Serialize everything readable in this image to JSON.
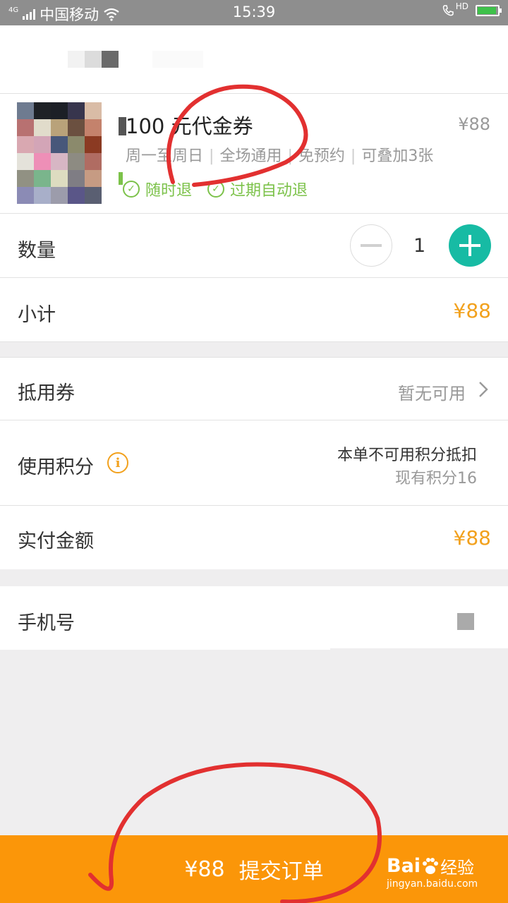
{
  "status": {
    "network": "4G",
    "carrier": "中国移动",
    "time": "15:39",
    "call_hd": "HD"
  },
  "product": {
    "title": "100 元代金券",
    "price": "¥88",
    "tags": [
      "周一至周日",
      "全场通用",
      "免预约",
      "可叠加3张"
    ],
    "badges": [
      "随时退",
      "过期自动退"
    ]
  },
  "quantity": {
    "label": "数量",
    "value": "1",
    "minus": "−",
    "plus": "+"
  },
  "subtotal": {
    "label": "小计",
    "value": "¥88"
  },
  "coupon": {
    "label": "抵用券",
    "value": "暂无可用",
    "chevron": "›"
  },
  "points": {
    "label": "使用积分",
    "info_icon": "i",
    "line1": "本单不可用积分抵扣",
    "line2": "现有积分16"
  },
  "paid": {
    "label": "实付金额",
    "value": "¥88"
  },
  "phone": {
    "label": "手机号"
  },
  "submit": {
    "price": "¥88",
    "label": "提交订单"
  },
  "watermark": {
    "brand": "Bai",
    "brand2": "经验",
    "url": "jingyan.baidu.com"
  },
  "colors": {
    "accent_orange": "#f2a11d",
    "submit_bg": "#fb9609",
    "green_badge": "#7cc24a",
    "teal_plus": "#17bba4",
    "annotation_red": "#e23030"
  }
}
